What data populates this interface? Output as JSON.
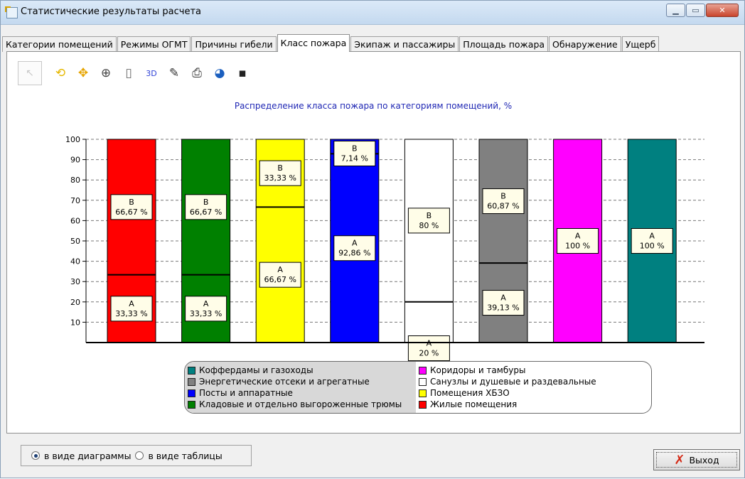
{
  "window": {
    "title": "Статистические результаты расчета",
    "buttons": {
      "minimize_icon": "minimize-icon",
      "maximize_icon": "maximize-icon",
      "close_icon": "close-icon"
    }
  },
  "tabs": [
    {
      "label": "Категории помещений",
      "active": false
    },
    {
      "label": "Режимы ОГМТ",
      "active": false
    },
    {
      "label": "Причины гибели",
      "active": false
    },
    {
      "label": "Класс пожара",
      "active": true
    },
    {
      "label": "Экипаж и пассажиры",
      "active": false
    },
    {
      "label": "Площадь пожара",
      "active": false
    },
    {
      "label": "Обнаружение",
      "active": false
    },
    {
      "label": "Ущерб",
      "active": false
    }
  ],
  "toolbar": {
    "icons": [
      "pointer-icon",
      "rotate-icon",
      "move-icon",
      "zoom-icon",
      "page-icon",
      "3d-icon",
      "edit-chart-icon",
      "print-icon",
      "palette-icon",
      "save-icon"
    ],
    "label_3d": "3D"
  },
  "chart_data": {
    "type": "bar",
    "stacked": true,
    "title": "Распределение класса пожара по категориям помещений, %",
    "xlabel": "",
    "ylabel": "",
    "ylim": [
      0,
      100
    ],
    "yticks": [
      10,
      20,
      30,
      40,
      50,
      60,
      70,
      80,
      90,
      100
    ],
    "grid": true,
    "categories": [
      "Жилые помещения",
      "Кладовые и отдельно выгороженные трюмы",
      "Помещения ХБЗО",
      "Посты и аппаратные",
      "Санузлы и душевые и раздевальные",
      "Энергетические отсеки и агрегатные",
      "Коридоры и тамбуры",
      "Коффердамы и газоходы"
    ],
    "bars": [
      {
        "category": "Жилые помещения",
        "color": "#ff0000",
        "segments": [
          {
            "class": "A",
            "value": 33.33,
            "label": "33,33 %"
          },
          {
            "class": "B",
            "value": 66.67,
            "label": "66,67 %"
          }
        ]
      },
      {
        "category": "Кладовые и отдельно выгороженные трюмы",
        "color": "#008000",
        "segments": [
          {
            "class": "A",
            "value": 33.33,
            "label": "33,33 %"
          },
          {
            "class": "B",
            "value": 66.67,
            "label": "66,67 %"
          }
        ]
      },
      {
        "category": "Помещения ХБЗО",
        "color": "#ffff00",
        "segments": [
          {
            "class": "A",
            "value": 66.67,
            "label": "66,67 %"
          },
          {
            "class": "B",
            "value": 33.33,
            "label": "33,33 %"
          }
        ]
      },
      {
        "category": "Посты и аппаратные",
        "color": "#0000ff",
        "segments": [
          {
            "class": "A",
            "value": 92.86,
            "label": "92,86 %"
          },
          {
            "class": "B",
            "value": 7.14,
            "label": "7,14 %"
          }
        ]
      },
      {
        "category": "Санузлы и душевые и раздевальные",
        "color": "#ffffff",
        "segments": [
          {
            "class": "A",
            "value": 20,
            "label": "20 %"
          },
          {
            "class": "B",
            "value": 80,
            "label": "80 %"
          }
        ]
      },
      {
        "category": "Энергетические отсеки и агрегатные",
        "color": "#808080",
        "segments": [
          {
            "class": "A",
            "value": 39.13,
            "label": "39,13 %"
          },
          {
            "class": "B",
            "value": 60.87,
            "label": "60,87 %"
          }
        ]
      },
      {
        "category": "Коридоры и тамбуры",
        "color": "#ff00ff",
        "segments": [
          {
            "class": "A",
            "value": 100,
            "label": "100 %"
          }
        ]
      },
      {
        "category": "Коффердамы и газоходы",
        "color": "#008080",
        "segments": [
          {
            "class": "A",
            "value": 100,
            "label": "100 %"
          }
        ]
      }
    ],
    "legend": {
      "placement": "bottom",
      "left": [
        {
          "label": "Коффердамы и газоходы",
          "color": "#008080"
        },
        {
          "label": "Энергетические отсеки и агрегатные",
          "color": "#808080"
        },
        {
          "label": "Посты и аппаратные",
          "color": "#0000ff"
        },
        {
          "label": "Кладовые и отдельно выгороженные трюмы",
          "color": "#008000"
        }
      ],
      "right": [
        {
          "label": "Коридоры и тамбуры",
          "color": "#ff00ff"
        },
        {
          "label": "Санузлы и душевые и раздевальные",
          "color": "#ffffff"
        },
        {
          "label": "Помещения ХБЗО",
          "color": "#ffff00"
        },
        {
          "label": "Жилые помещения",
          "color": "#ff0000"
        }
      ]
    }
  },
  "view_mode": {
    "options": [
      {
        "label": "в виде диаграммы",
        "checked": true
      },
      {
        "label": "в виде таблицы",
        "checked": false
      }
    ]
  },
  "exit_button": {
    "label": "Выход"
  }
}
